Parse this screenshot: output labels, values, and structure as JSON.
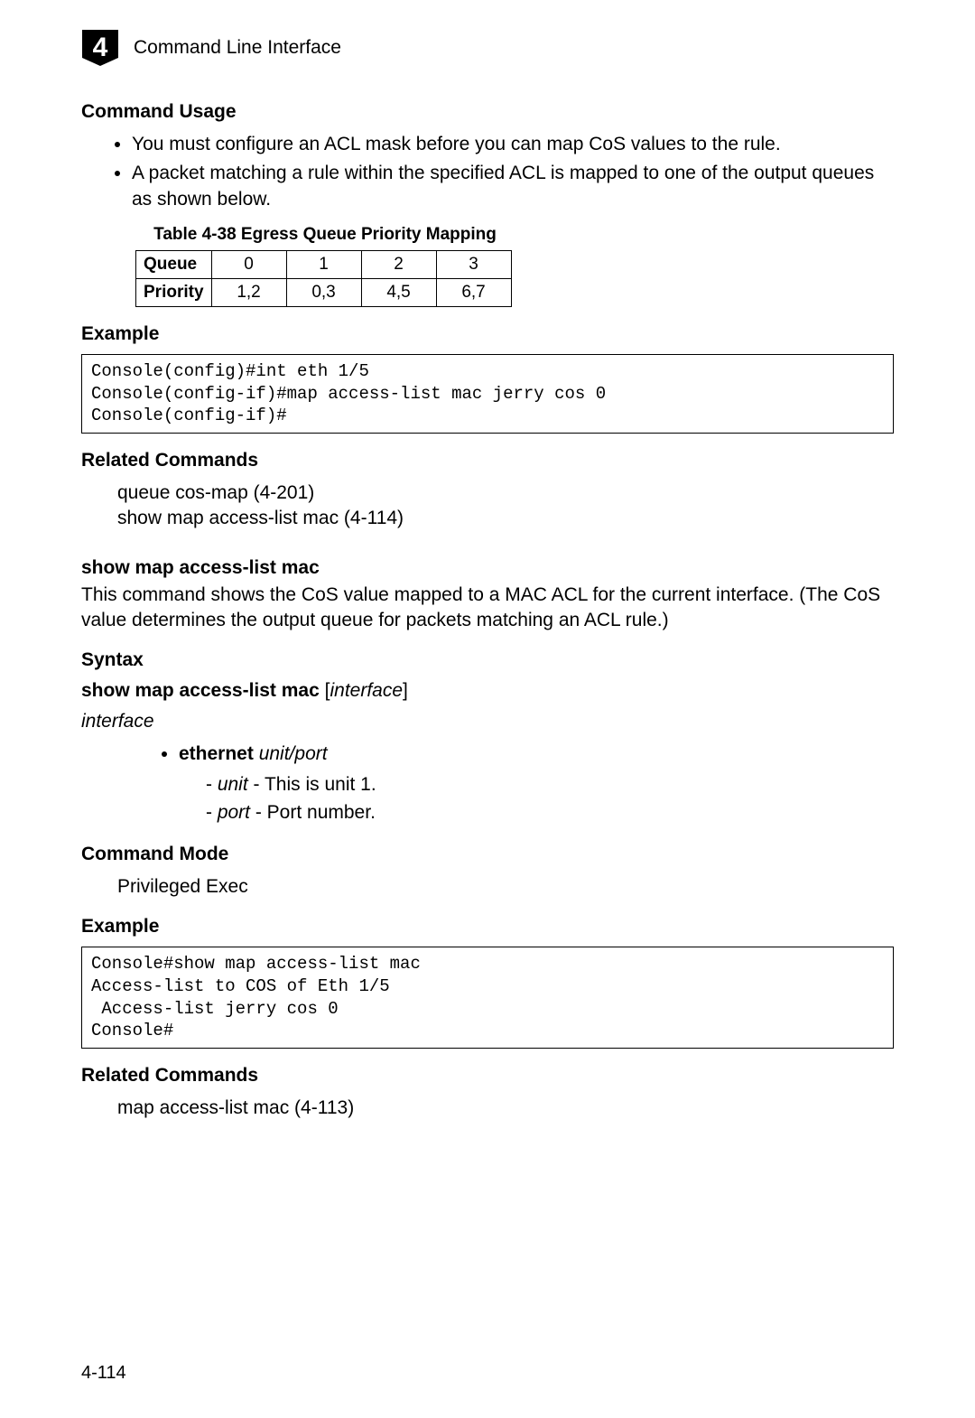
{
  "header": {
    "chapter_number": "4",
    "title": "Command Line Interface"
  },
  "section_command_usage": {
    "heading": "Command Usage",
    "bullets": [
      "You must configure an ACL mask before you can map CoS values to the rule.",
      "A packet matching a rule within the specified ACL is mapped to one of the output queues as shown below."
    ]
  },
  "table": {
    "caption": "Table 4-38  Egress Queue Priority Mapping",
    "row1_label": "Queue",
    "row1_cells": [
      "0",
      "1",
      "2",
      "3"
    ],
    "row2_label": "Priority",
    "row2_cells": [
      "1,2",
      "0,3",
      "4,5",
      "6,7"
    ]
  },
  "example1": {
    "heading": "Example",
    "code": "Console(config)#int eth 1/5\nConsole(config-if)#map access-list mac jerry cos 0\nConsole(config-if)#"
  },
  "related1": {
    "heading": "Related Commands",
    "lines": [
      "queue cos-map (4-201)",
      "show map access-list mac (4-114)"
    ]
  },
  "cmd2": {
    "heading": "show map access-list mac",
    "desc": "This command shows the CoS value mapped to a MAC ACL for the current interface. (The CoS value determines the output queue for packets matching an ACL rule.)"
  },
  "syntax": {
    "heading": "Syntax",
    "line_kw": "show map access-list mac",
    "line_arg": "interface",
    "interface_label": "interface",
    "ethernet_kw": "ethernet",
    "ethernet_arg": "unit/port",
    "unit_arg": "unit",
    "unit_desc": " - This is unit 1.",
    "port_arg": "port",
    "port_desc": " - Port number."
  },
  "command_mode": {
    "heading": "Command Mode",
    "value": "Privileged Exec"
  },
  "example2": {
    "heading": "Example",
    "code": "Console#show map access-list mac\nAccess-list to COS of Eth 1/5\n Access-list jerry cos 0\nConsole#"
  },
  "related2": {
    "heading": "Related Commands",
    "lines": [
      "map access-list mac (4-113)"
    ]
  },
  "page_number": "4-114"
}
